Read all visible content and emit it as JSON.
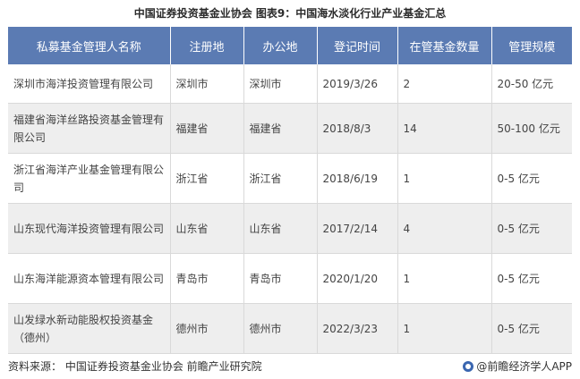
{
  "title": "中国证券投资基金业协会  图表9：中国海水淡化行业产业基金汇总",
  "table": {
    "headers": [
      "私募基金管理人名称",
      "注册地",
      "办公地",
      "登记时间",
      "在管基金数量",
      "管理规模"
    ],
    "rows": [
      [
        "深圳市海洋投资管理有限公司",
        "深圳市",
        "深圳市",
        "2019/3/26",
        "2",
        "20-50 亿元"
      ],
      [
        "福建省海洋丝路投资基金管理有限公司",
        "福建省",
        "福建省",
        "2018/8/3",
        "14",
        "50-100 亿元"
      ],
      [
        "浙江省海洋产业基金管理有限公司",
        "浙江省",
        "浙江省",
        "2018/6/19",
        "1",
        "0-5 亿元"
      ],
      [
        "山东现代海洋投资管理有限公司",
        "山东省",
        "山东省",
        "2017/2/14",
        "4",
        "0-5 亿元"
      ],
      [
        "山东海洋能源资本管理有限公司",
        "青岛市",
        "青岛市",
        "2020/1/20",
        "1",
        "0-5 亿元"
      ],
      [
        "山发绿水新动能股权投资基金（德州）",
        "德州市",
        "德州市",
        "2022/3/23",
        "1",
        "0-5 亿元"
      ]
    ]
  },
  "footer": {
    "source": "资料来源：  中国证券投资基金业协会 前瞻产业研究院",
    "brand": "@前瞻经济学人APP",
    "brand_icon": "qianzhan-logo-icon"
  }
}
